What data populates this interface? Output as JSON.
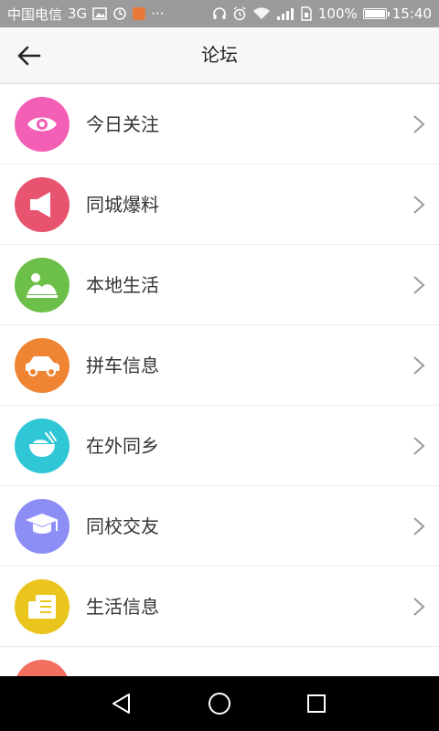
{
  "status_bar": {
    "carrier": "中国电信",
    "network": "3G",
    "dots": "···",
    "battery_percent_text": "100%",
    "battery_level": 1.0,
    "time": "15:40",
    "icons": [
      "image-icon",
      "sync-icon",
      "app-badge-icon",
      "headset-icon",
      "alarm-icon",
      "wifi-icon",
      "signal-icon",
      "sim-icon",
      "battery-icon"
    ]
  },
  "header": {
    "title": "论坛",
    "back_icon": "back-arrow-icon"
  },
  "forum_items": [
    {
      "label": "今日关注",
      "icon": "eye-icon",
      "color": "#f45fb6"
    },
    {
      "label": "同城爆料",
      "icon": "megaphone-icon",
      "color": "#e8546f"
    },
    {
      "label": "本地生活",
      "icon": "landscape-icon",
      "color": "#6cc04a"
    },
    {
      "label": "拼车信息",
      "icon": "car-icon",
      "color": "#ef8533"
    },
    {
      "label": "在外同乡",
      "icon": "bowl-icon",
      "color": "#2fc7d6"
    },
    {
      "label": "同校交友",
      "icon": "graduation-cap-icon",
      "color": "#8c8ef5"
    },
    {
      "label": "生活信息",
      "icon": "document-icon",
      "color": "#e9c51e"
    },
    {
      "label": "",
      "icon": "partial-icon",
      "color": "#f36f60"
    }
  ],
  "nav_bar": {
    "back_icon": "nav-back-icon",
    "home_icon": "nav-home-icon",
    "recents_icon": "nav-recents-icon"
  },
  "colors": {
    "status_bar_bg": "#9b9b9b",
    "header_bg": "#f7f7f7",
    "chevron": "#9a9a9a",
    "nav_bar_bg": "#000000"
  }
}
